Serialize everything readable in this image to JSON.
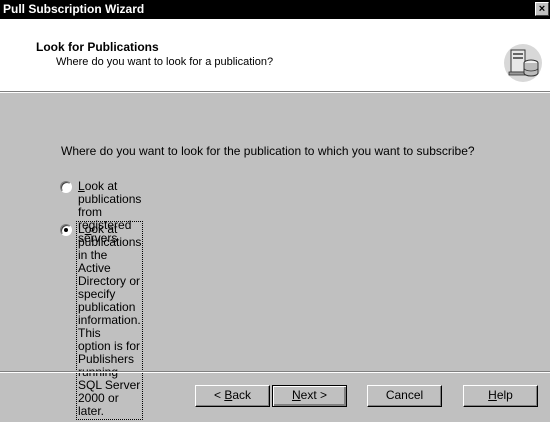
{
  "window": {
    "title": "Pull Subscription Wizard",
    "close_label": "×"
  },
  "header": {
    "heading": "Look for Publications",
    "subheading": "Where do you want to look for a publication?"
  },
  "content": {
    "question": "Where do you want to look for the publication to which you want to subscribe?",
    "options": [
      {
        "mnemonic": "L",
        "rest": "ook at publications from registered servers",
        "selected": false
      },
      {
        "mnemonic": "o",
        "prefix": "L",
        "rest": "ok at publications in the Active Directory or specify publication information. This",
        "line2": "option is for Publishers running SQL Server 2000 or later.",
        "selected": true
      }
    ]
  },
  "buttons": {
    "back_prefix": "< ",
    "back_mnemonic": "B",
    "back_rest": "ack",
    "next_mnemonic": "N",
    "next_rest": "ext >",
    "cancel": "Cancel",
    "help_mnemonic": "H",
    "help_rest": "elp"
  },
  "colors": {
    "face": "#c0c0c0",
    "titlebar": "#000000",
    "header_bg": "#ffffff"
  }
}
